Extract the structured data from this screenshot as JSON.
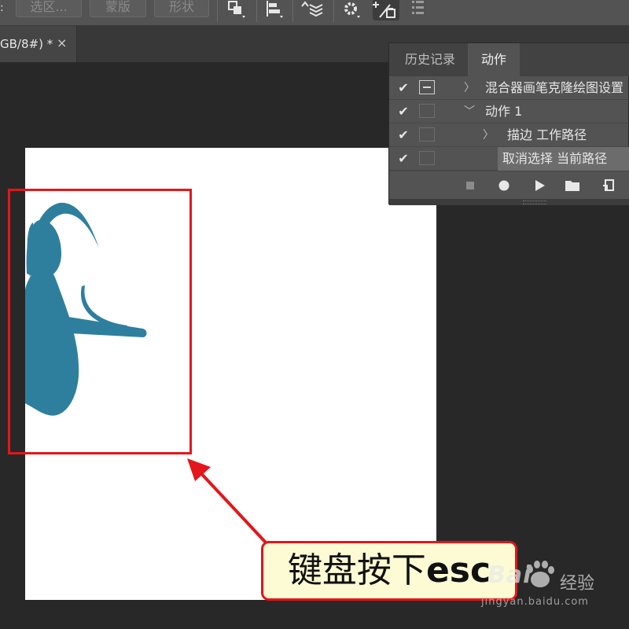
{
  "options_bar": {
    "colon": ":",
    "buttons": [
      "选区...",
      "蒙版",
      "形状"
    ]
  },
  "doc_tab": {
    "title": "GB/8#) *",
    "close": "×"
  },
  "actions_panel": {
    "tabs": [
      "历史记录",
      "动作"
    ],
    "active_tab": "动作",
    "rows": [
      {
        "checked": "✔",
        "label": "混合器画笔克隆绘图设置",
        "expander": "〉"
      },
      {
        "checked": "✔",
        "label": "动作 1",
        "expander": "﹀"
      },
      {
        "checked": "✔",
        "label": "描边 工作路径",
        "expander": "〉"
      },
      {
        "checked": "✔",
        "label": "取消选择 当前路径",
        "expander": ""
      }
    ],
    "footer_icons": [
      "stop-icon",
      "record-icon",
      "play-icon",
      "folder-icon",
      "new-action-icon"
    ]
  },
  "annotation": {
    "callout_text_cn": "键盘按下",
    "callout_text_key": "esc",
    "accent_color": "#e3161b"
  },
  "watermark": {
    "brand": "Bai",
    "name": "经验",
    "url": "jingyan.baidu.com"
  },
  "colors": {
    "stroke_color": "#2e7f9e",
    "workspace": "#282828",
    "panel": "#535353"
  }
}
